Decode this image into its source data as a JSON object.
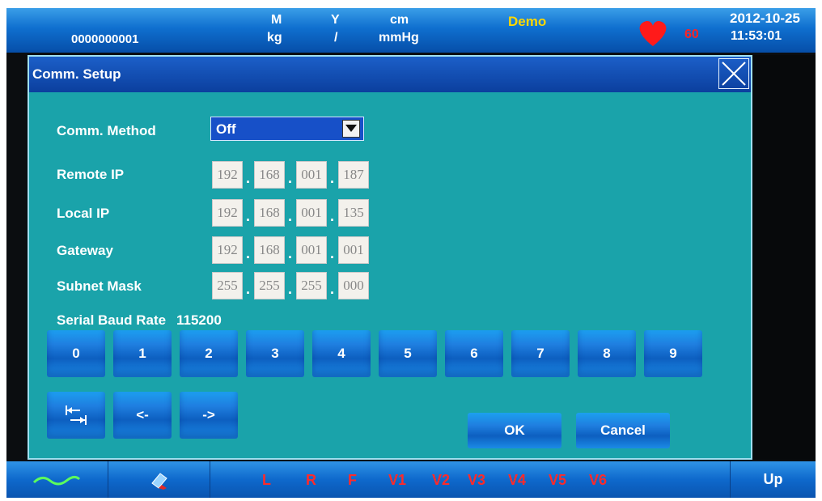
{
  "topbar": {
    "patient_id": "0000000001",
    "sex": "M",
    "weight_unit": "kg",
    "age_unit": "Y",
    "slash": "/",
    "height_unit": "cm",
    "pressure_unit": "mmHg",
    "mode": "Demo",
    "heart_rate": "60",
    "date": "2012-10-25",
    "time": "11:53:01"
  },
  "dialog": {
    "title": "Comm. Setup",
    "comm_method_label": "Comm. Method",
    "comm_method_value": "Off",
    "remote_ip_label": "Remote IP",
    "remote_ip": [
      "192",
      "168",
      "001",
      "187"
    ],
    "local_ip_label": "Local IP",
    "local_ip": [
      "192",
      "168",
      "001",
      "135"
    ],
    "gateway_label": "Gateway",
    "gateway": [
      "192",
      "168",
      "001",
      "001"
    ],
    "subnet_label": "Subnet Mask",
    "subnet": [
      "255",
      "255",
      "255",
      "000"
    ],
    "ip_separator": ".",
    "baud_label": "Serial Baud Rate",
    "baud_value": "115200",
    "keypad": [
      "0",
      "1",
      "2",
      "3",
      "4",
      "5",
      "6",
      "7",
      "8",
      "9"
    ],
    "nav_keys": {
      "tab": "tab-icon",
      "left": "<-",
      "right": "->"
    },
    "ok_label": "OK",
    "cancel_label": "Cancel"
  },
  "bottombar": {
    "leads": [
      "L",
      "R",
      "F",
      "V1",
      "V2",
      "V3",
      "V4",
      "V5",
      "V6"
    ],
    "up_label": "Up"
  },
  "colors": {
    "dialog_bg": "#1aa3aa",
    "title_bg": "#1c5fc8",
    "demo": "#ffd800",
    "heart": "#ff1a1a",
    "lead_text": "#ff2a2a",
    "wave": "#5cff5c"
  },
  "icons": [
    "heart-icon",
    "close-icon",
    "dropdown-arrow-icon",
    "tab-icon",
    "ecg-wave-icon",
    "eraser-icon"
  ]
}
